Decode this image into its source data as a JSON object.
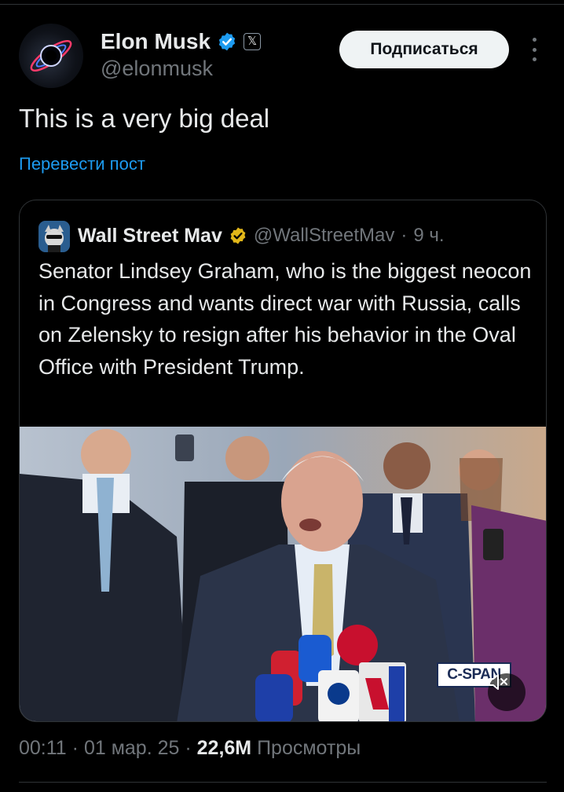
{
  "author": {
    "name": "Elon Musk",
    "handle": "@elonmusk",
    "avatar_icon": "elon-avatar-blackhole",
    "verified_icon": "verified-badge-icon",
    "affiliation_icon": "x-logo-icon",
    "affiliation_label": "𝕏"
  },
  "follow_button": {
    "label": "Подписаться"
  },
  "more_icon": "more-vertical-icon",
  "post": {
    "text": "This is a very big deal",
    "translate_link": "Перевести пост"
  },
  "quoted": {
    "name": "Wall Street Mav",
    "handle": "@WallStreetMav",
    "separator": "·",
    "time": "9 ч.",
    "text": "Senator Lindsey Graham, who is the biggest neocon in Congress and wants direct war with Russia, calls on Zelensky to resign after his behavior in the Oval Office with President Trump.",
    "video": {
      "watermark": "C-SPAN",
      "mute_icon": "volume-muted-icon"
    }
  },
  "meta": {
    "time": "00:11",
    "sep1": "·",
    "date": "01 мар. 25",
    "sep2": "·",
    "views_count": "22,6M",
    "views_label": "Просмотры"
  },
  "colors": {
    "background": "#000000",
    "text": "#e7e9ea",
    "secondary": "#71767b",
    "link": "#1d9bf0",
    "verified_blue": "#1d9bf0",
    "verified_gold": "#e2b719"
  }
}
